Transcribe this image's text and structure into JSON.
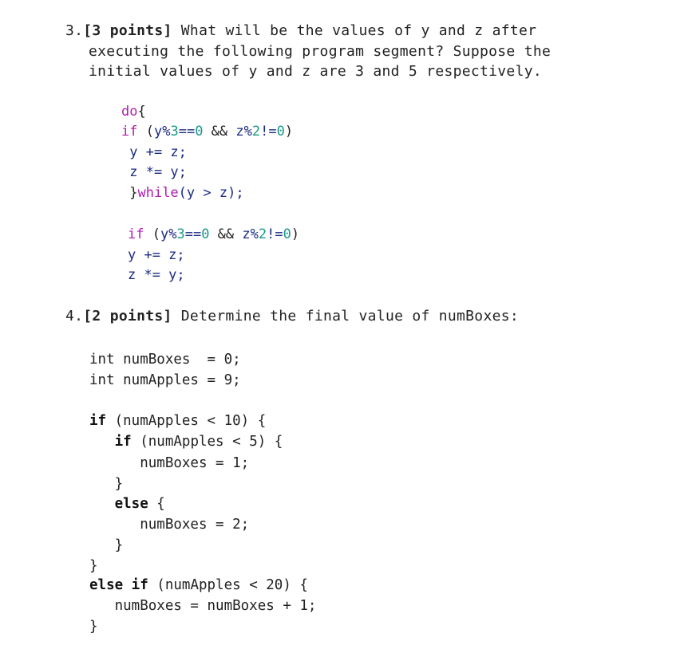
{
  "question3": {
    "number": "3.",
    "points": "[3 points]",
    "line1_rest": " What will be the values of y and z after",
    "line2": "executing the following program segment? Suppose the",
    "line3": "initial values of y and z are 3 and 5 respectively.",
    "code_block1": {
      "do_kw": "do",
      "do_brace": "{",
      "if_kw": "if",
      "cond_open": " (",
      "cond_a": "y%",
      "cond_3": "3",
      "cond_eq": "==",
      "cond_0a": "0",
      "cond_and": " && ",
      "cond_b": "z%",
      "cond_2": "2",
      "cond_ne": "!=",
      "cond_0b": "0",
      "cond_close": ")",
      "stmt1": " y += z;",
      "stmt2": " z *= y;",
      "close_brace": " }",
      "while_kw": "while",
      "while_cond": "(y > z);"
    },
    "code_block2": {
      "if_kw": "if",
      "cond_open": " (",
      "cond_a": "y%",
      "cond_3": "3",
      "cond_eq": "==",
      "cond_0a": "0",
      "cond_and": " && ",
      "cond_b": "z%",
      "cond_2": "2",
      "cond_ne": "!=",
      "cond_0b": "0",
      "cond_close": ")",
      "stmt1": "y += z;",
      "stmt2": "z *= y;"
    }
  },
  "question4": {
    "number": "4.",
    "points": "[2 points]",
    "prompt": " Determine the final value of numBoxes:",
    "decl1": "int numBoxes  = 0;",
    "decl2": "int numApples = 9;",
    "lines": [
      {
        "kw": "if",
        "rest": " (numApples < 10) {"
      },
      {
        "kw": "   if",
        "rest": " (numApples < 5) {"
      },
      {
        "kw": "",
        "rest": "      numBoxes = 1;"
      },
      {
        "kw": "",
        "rest": "   }"
      },
      {
        "kw": "   else",
        "rest": " {"
      },
      {
        "kw": "",
        "rest": "      numBoxes = 2;"
      },
      {
        "kw": "",
        "rest": "   }"
      },
      {
        "kw": "",
        "rest": "}"
      },
      {
        "kw": "else if",
        "rest": " (numApples < 20) {"
      },
      {
        "kw": "",
        "rest": "   numBoxes = numBoxes + 1;"
      },
      {
        "kw": "",
        "rest": "}"
      }
    ]
  }
}
